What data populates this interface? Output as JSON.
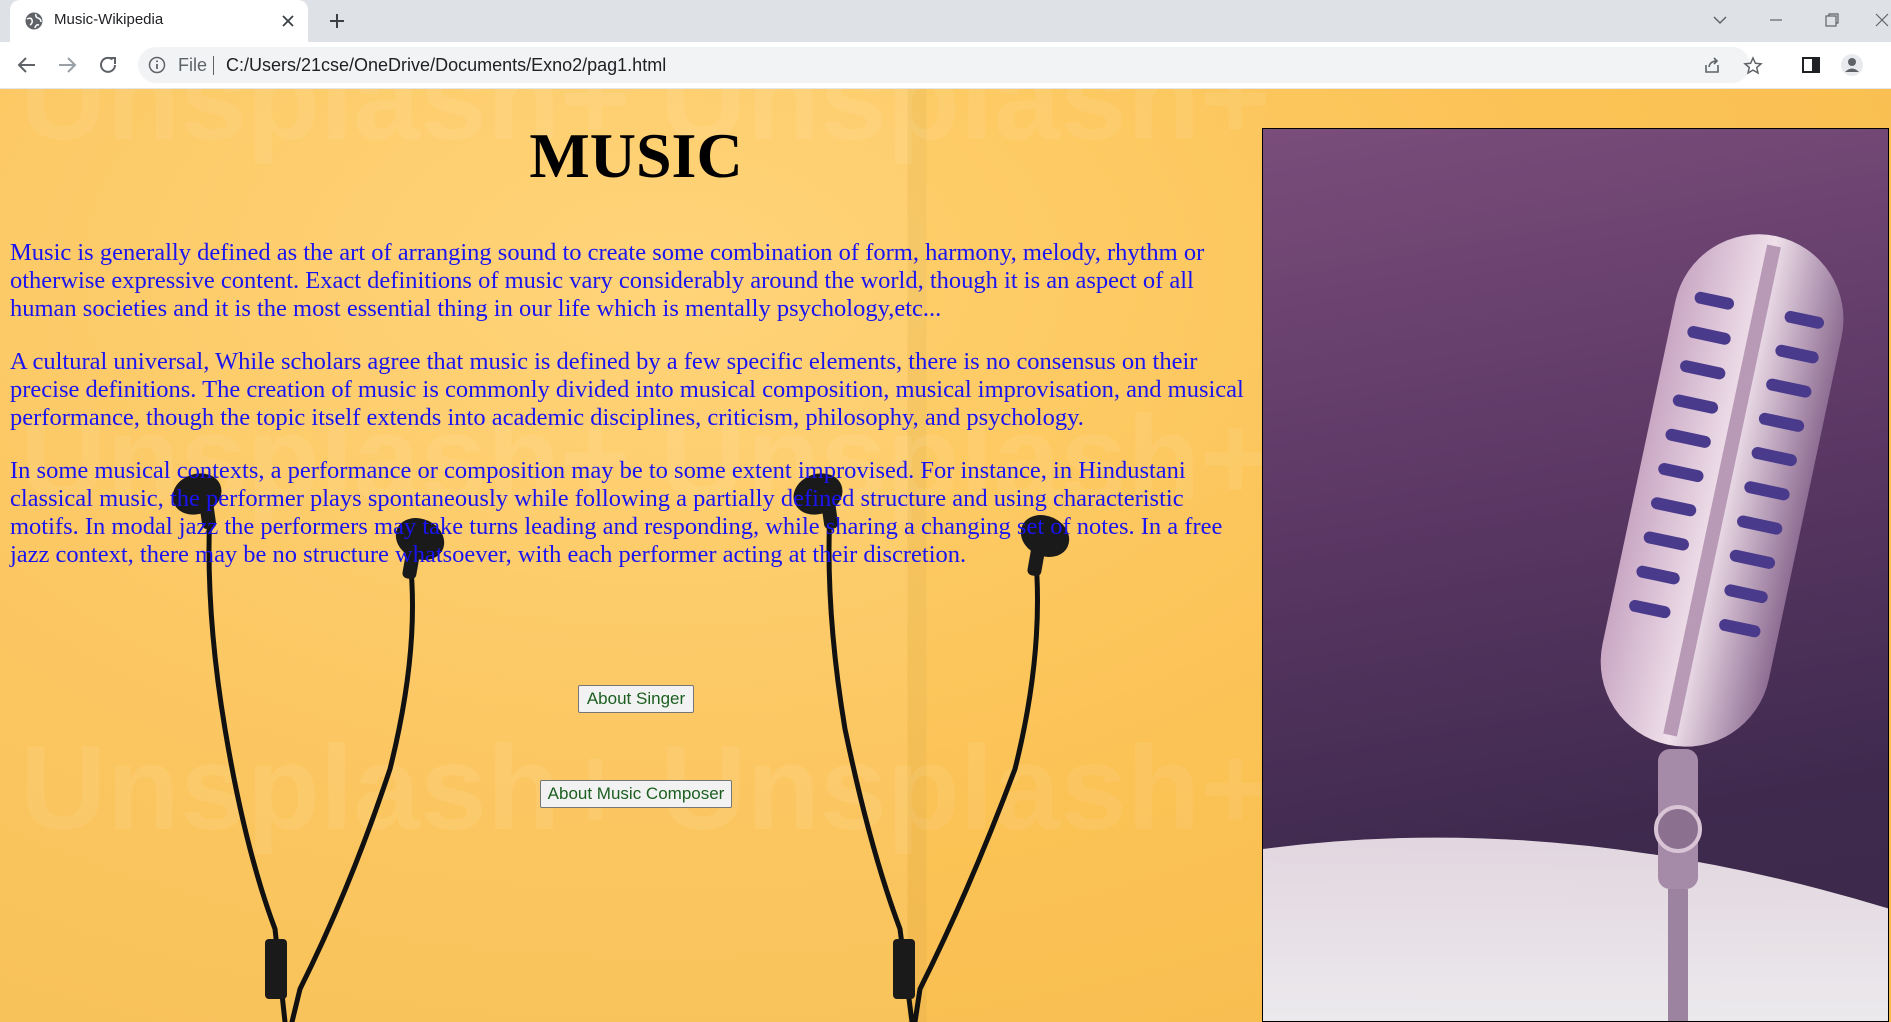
{
  "browser": {
    "tab": {
      "title": "Music-Wikipedia",
      "favicon": "globe-icon",
      "close_icon": "close-icon"
    },
    "new_tab_icon": "plus-icon",
    "window_controls": [
      "chevron-down-icon",
      "minimize-icon",
      "restore-icon",
      "close-icon"
    ],
    "nav": {
      "back_icon": "arrow-left-icon",
      "forward_icon": "arrow-right-icon",
      "reload_icon": "reload-icon"
    },
    "address_bar": {
      "info_icon": "info-icon",
      "scheme_label": "File",
      "url": "C:/Users/21cse/OneDrive/Documents/Exno2/pag1.html",
      "share_icon": "share-icon",
      "bookmark_icon": "star-icon"
    },
    "toolbar_right": [
      "side-panel-icon",
      "profile-icon"
    ]
  },
  "page": {
    "heading": "MUSIC",
    "paragraphs": [
      "Music is generally defined as the art of arranging sound to create some combination of form, harmony, melody, rhythm or otherwise expressive content. Exact definitions of music vary considerably around the world, though it is an aspect of all human societies and it is the most essential thing in our life which is mentally psychology,etc...",
      "A cultural universal, While scholars agree that music is defined by a few specific elements, there is no consensus on their precise definitions. The creation of music is commonly divided into musical composition, musical improvisation, and musical performance, though the topic itself extends into academic disciplines, criticism, philosophy, and psychology.",
      "In some musical contexts, a performance or composition may be to some extent improvised. For instance, in Hindustani classical music, the performer plays spontaneously while following a partially defined structure and using characteristic motifs. In modal jazz the performers may take turns leading and responding, while sharing a changing set of notes. In a free jazz context, there may be no structure whatsoever, with each performer acting at their discretion."
    ],
    "buttons": {
      "singer": "About Singer",
      "composer": "About Music Composer"
    },
    "background": {
      "description_icon": "earphones-image",
      "watermark": "Unsplash+"
    },
    "side_image": "microphone-image",
    "colors": {
      "paragraph_text": "#1a14f0",
      "heading_text": "#000000",
      "background": "#fbc255",
      "button_text": "#1b5e20"
    }
  }
}
